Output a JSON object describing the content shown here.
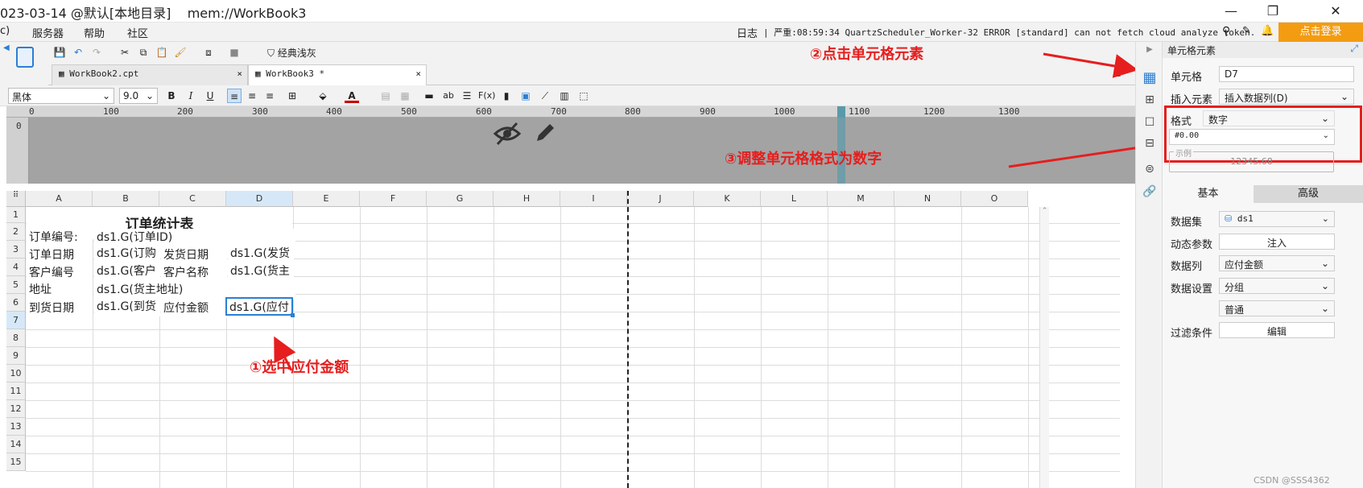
{
  "title": "023-03-14 @默认[本地目录]    mem://WorkBook3",
  "window_controls": {
    "min": "—",
    "max": "❐",
    "close": "✕"
  },
  "menu": [
    "c)",
    "服务器",
    "帮助",
    "社区"
  ],
  "log": {
    "label": "日志",
    "message": "严重:08:59:34 QuartzScheduler_Worker-32 ERROR [standard] can not fetch cloud analyze token."
  },
  "login_button": "点击登录",
  "toolbar": {
    "theme_label": "经典浅灰"
  },
  "tabs": [
    {
      "label": "WorkBook2.cpt",
      "close": "×"
    },
    {
      "label": "WorkBook3 *",
      "close": "×"
    }
  ],
  "format": {
    "font": "黑体",
    "size": "9.0"
  },
  "ruler": [
    "0",
    "100",
    "200",
    "300",
    "400",
    "500",
    "600",
    "700",
    "800",
    "900",
    "1000",
    "1100",
    "1200",
    "1300"
  ],
  "vruler": "0",
  "columns": [
    "A",
    "B",
    "C",
    "D",
    "E",
    "F",
    "G",
    "H",
    "I",
    "J",
    "K",
    "L",
    "M",
    "N",
    "O"
  ],
  "rows": [
    "1",
    "2",
    "3",
    "4",
    "5",
    "6",
    "7",
    "8",
    "9",
    "10",
    "11",
    "12",
    "13",
    "14",
    "15"
  ],
  "cells": {
    "title": "订单统计表",
    "a3": "订单编号:",
    "b3": "ds1.G(订单ID)",
    "a4": "订单日期",
    "b4": "ds1.G(订购",
    "c4": "发货日期",
    "d4": "ds1.G(发货",
    "a5": "客户编号",
    "b5": "ds1.G(客户",
    "c5": "客户名称",
    "d5": "ds1.G(货主",
    "a6": "地址",
    "b6": "ds1.G(货主地址)",
    "a7": "到货日期",
    "b7": "ds1.G(到货",
    "c7": "应付金额",
    "d7": "ds1.G(应付"
  },
  "annotations": {
    "step1": "①选中应付金额",
    "step2": "②点击单元格元素",
    "step3": "③调整单元格格式为数字"
  },
  "props": {
    "header": "单元格元素",
    "cell_label": "单元格",
    "cell_value": "D7",
    "insert_label": "插入元素",
    "insert_value": "插入数据列(D)",
    "format_label": "格式",
    "format_value": "数字",
    "pattern_value": "#0.00",
    "example_label": "示例",
    "example_value": "12345.68",
    "tab_basic": "基本",
    "tab_advanced": "高级",
    "dataset_label": "数据集",
    "dataset_value": "ds1",
    "param_label": "动态参数",
    "param_button": "注入",
    "column_label": "数据列",
    "column_value": "应付金额",
    "setting_label": "数据设置",
    "setting_value": "分组",
    "setting_value2": "普通",
    "filter_label": "过滤条件",
    "filter_button": "编辑"
  },
  "watermark": "CSDN @SSS4362"
}
